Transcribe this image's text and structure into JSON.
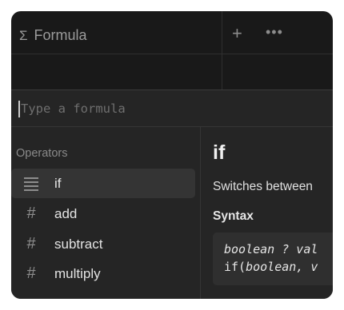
{
  "header": {
    "column_icon": "Σ",
    "column_title": "Formula",
    "add_icon": "+",
    "more_icon": "•••"
  },
  "formula_input": {
    "placeholder": "Type a formula"
  },
  "operators": {
    "title": "Operators",
    "items": [
      {
        "icon": "lines-icon",
        "label": "if",
        "selected": true
      },
      {
        "icon": "#",
        "label": "add"
      },
      {
        "icon": "#",
        "label": "subtract"
      },
      {
        "icon": "#",
        "label": "multiply"
      }
    ]
  },
  "detail": {
    "title": "if",
    "description": "Switches between",
    "syntax_title": "Syntax",
    "syntax_line1": "boolean ? val",
    "syntax_line2_prefix": "if(",
    "syntax_line2_arg": "boolean, v"
  }
}
